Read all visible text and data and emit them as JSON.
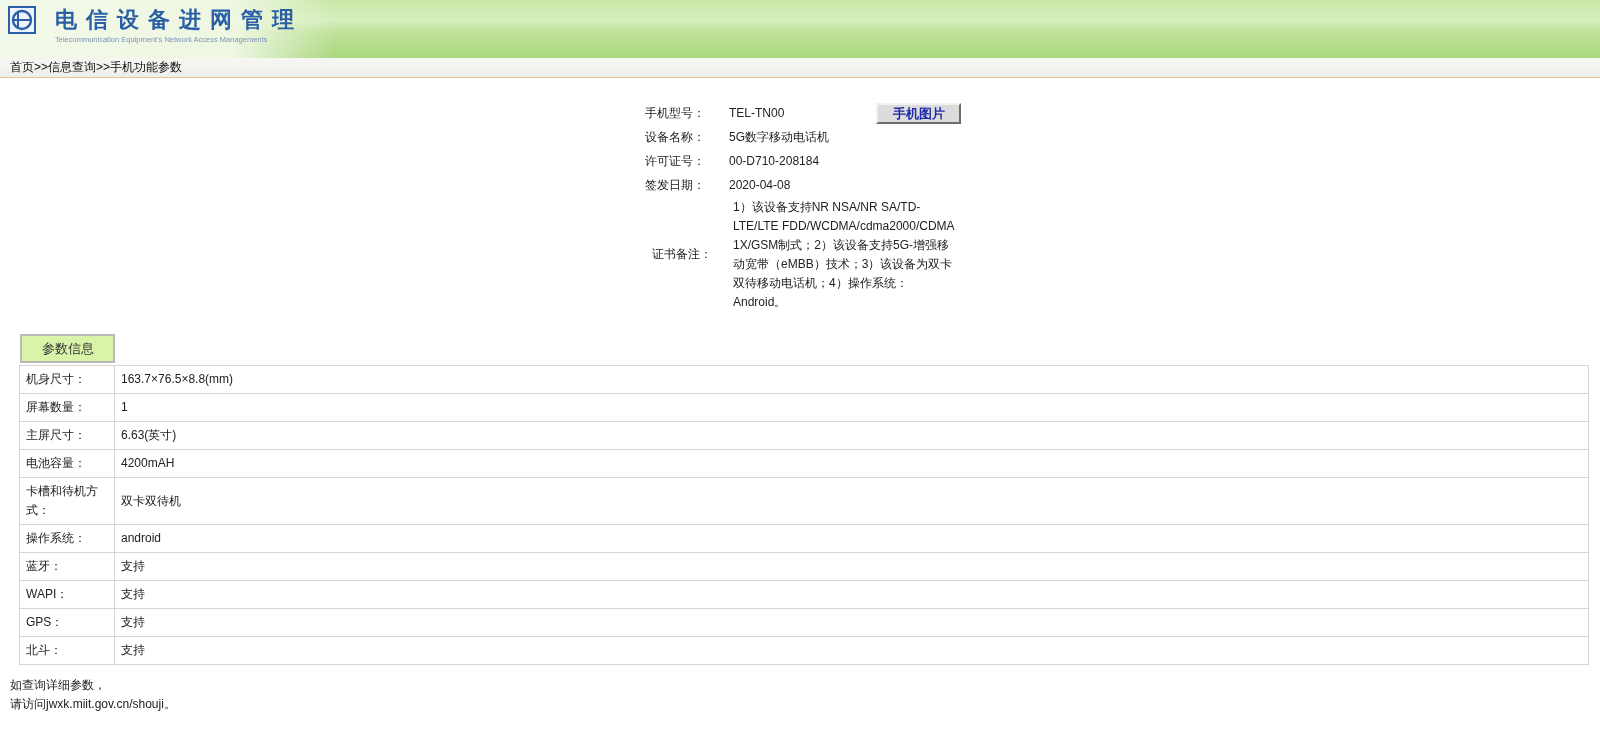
{
  "header": {
    "title": "电信设备进网管理",
    "subtitle": "Telecommunication Equipment's Network Access Managements"
  },
  "breadcrumb": "首页>>信息查询>>手机功能参数",
  "summary": {
    "fields": [
      {
        "label": "手机型号：",
        "value": "TEL-TN00"
      },
      {
        "label": "设备名称：",
        "value": "5G数字移动电话机"
      },
      {
        "label": "许可证号：",
        "value": "00-D710-208184"
      },
      {
        "label": "签发日期：",
        "value": "2020-04-08"
      }
    ],
    "photo_button": "手机图片",
    "remarks": {
      "label": "证书备注：",
      "value": "1）该设备支持NR NSA/NR SA/TD-LTE/LTE FDD/WCDMA/cdma2000/CDMA 1X/GSM制式；2）该设备支持5G-增强移动宽带（eMBB）技术；3）该设备为双卡双待移动电话机；4）操作系统：Android。"
    }
  },
  "params_tab": "参数信息",
  "params": [
    {
      "label": "机身尺寸：",
      "value": "163.7×76.5×8.8(mm)"
    },
    {
      "label": "屏幕数量：",
      "value": "1"
    },
    {
      "label": "主屏尺寸：",
      "value": "6.63(英寸)"
    },
    {
      "label": "电池容量：",
      "value": "4200mAH"
    },
    {
      "label": "卡槽和待机方式：",
      "value": "双卡双待机"
    },
    {
      "label": "操作系统：",
      "value": "android"
    },
    {
      "label": "蓝牙：",
      "value": "支持"
    },
    {
      "label": "WAPI：",
      "value": "支持"
    },
    {
      "label": "GPS：",
      "value": "支持"
    },
    {
      "label": "北斗：",
      "value": "支持"
    }
  ],
  "footer_lines": [
    "如查询详细参数，",
    "请访问jwxk.miit.gov.cn/shouji。"
  ]
}
